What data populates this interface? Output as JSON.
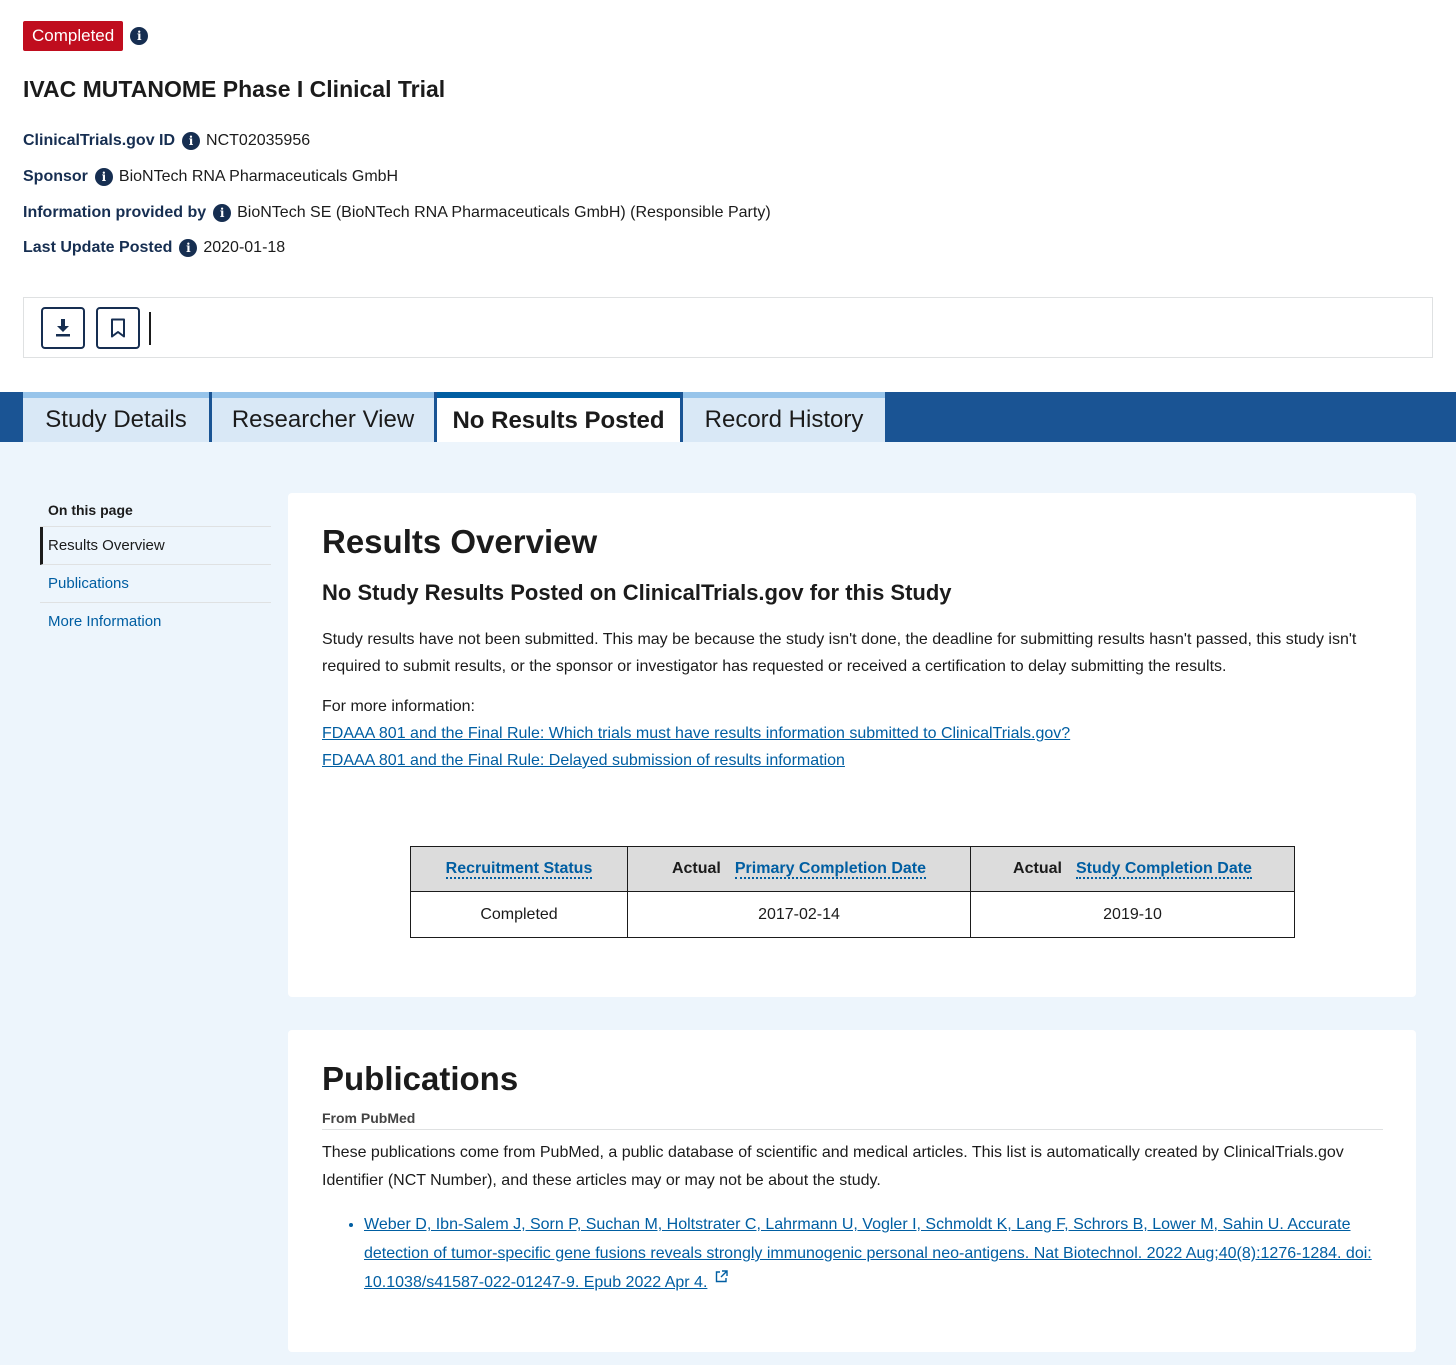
{
  "status": {
    "badge": "Completed"
  },
  "study": {
    "title": "IVAC MUTANOME Phase I Clinical Trial",
    "meta": [
      {
        "label": "ClinicalTrials.gov ID",
        "value": "NCT02035956"
      },
      {
        "label": "Sponsor",
        "value": "BioNTech RNA Pharmaceuticals GmbH"
      },
      {
        "label": "Information provided by",
        "value": "BioNTech SE (BioNTech RNA Pharmaceuticals GmbH) (Responsible Party)"
      },
      {
        "label": "Last Update Posted",
        "value": "2020-01-18"
      }
    ]
  },
  "toolbar": {
    "download_icon": "download-icon",
    "bookmark_icon": "bookmark-icon"
  },
  "tabs": [
    {
      "label": "Study Details"
    },
    {
      "label": "Researcher View"
    },
    {
      "label": "No Results Posted",
      "active": true
    },
    {
      "label": "Record History"
    }
  ],
  "sidebar": {
    "heading": "On this page",
    "items": [
      {
        "label": "Results Overview",
        "current": true
      },
      {
        "label": "Publications"
      },
      {
        "label": "More Information"
      }
    ]
  },
  "results": {
    "heading": "Results Overview",
    "subheading": "No Study Results Posted on ClinicalTrials.gov for this Study",
    "body": "Study results have not been submitted. This may be because the study isn't done, the deadline for submitting results hasn't passed, this study isn't required to submit results, or the sponsor or investigator has requested or received a certification to delay submitting the results.",
    "more_info_label": "For more information:",
    "links": [
      "FDAAA 801 and the Final Rule: Which trials must have results information submitted to ClinicalTrials.gov?",
      "FDAAA 801 and the Final Rule: Delayed submission of results information"
    ],
    "table": {
      "headers": [
        {
          "prefix": "",
          "label": "Recruitment Status"
        },
        {
          "prefix": "Actual",
          "label": "Primary Completion Date"
        },
        {
          "prefix": "Actual",
          "label": "Study Completion Date"
        }
      ],
      "row": [
        "Completed",
        "2017-02-14",
        "2019-10"
      ]
    }
  },
  "publications": {
    "heading": "Publications",
    "source": "From PubMed",
    "body": "These publications come from PubMed, a public database of scientific and medical articles. This list is automatically created by ClinicalTrials.gov Identifier (NCT Number), and these articles may or may not be about the study.",
    "items": [
      "Weber D, Ibn-Salem J, Sorn P, Suchan M, Holtstrater C, Lahrmann U, Vogler I, Schmoldt K, Lang F, Schrors B, Lower M, Sahin U. Accurate detection of tumor-specific gene fusions reveals strongly immunogenic personal neo-antigens. Nat Biotechnol. 2022 Aug;40(8):1276-1284. doi: 10.1038/s41587-022-01247-9. Epub 2022 Apr 4."
    ]
  }
}
